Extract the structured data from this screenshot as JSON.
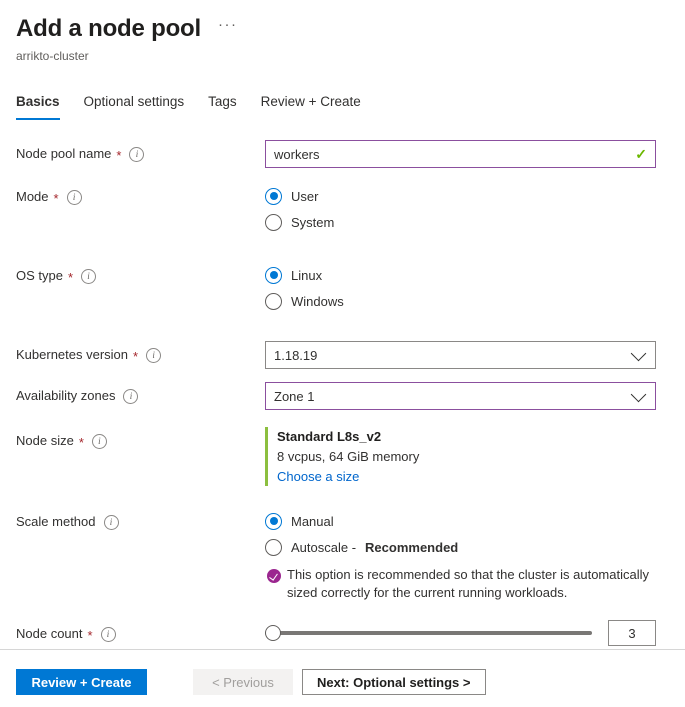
{
  "header": {
    "title": "Add a node pool",
    "subtitle": "arrikto-cluster",
    "more_menu": "···"
  },
  "tabs": [
    {
      "label": "Basics",
      "active": true
    },
    {
      "label": "Optional settings",
      "active": false
    },
    {
      "label": "Tags",
      "active": false
    },
    {
      "label": "Review + Create",
      "active": false
    }
  ],
  "form": {
    "node_pool_name": {
      "label": "Node pool name",
      "required": "*",
      "value": "workers",
      "validation_icon": "✓"
    },
    "mode": {
      "label": "Mode",
      "required": "*",
      "options": [
        {
          "label": "User",
          "selected": true
        },
        {
          "label": "System",
          "selected": false
        }
      ]
    },
    "os_type": {
      "label": "OS type",
      "required": "*",
      "options": [
        {
          "label": "Linux",
          "selected": true
        },
        {
          "label": "Windows",
          "selected": false
        }
      ]
    },
    "kubernetes_version": {
      "label": "Kubernetes version",
      "required": "*",
      "value": "1.18.19"
    },
    "availability_zones": {
      "label": "Availability zones",
      "required": "",
      "value": "Zone 1"
    },
    "node_size": {
      "label": "Node size",
      "required": "*",
      "size_name": "Standard L8s_v2",
      "size_spec": "8 vcpus, 64 GiB memory",
      "choose_link": "Choose a size"
    },
    "scale_method": {
      "label": "Scale method",
      "required": "",
      "options": [
        {
          "label": "Manual",
          "selected": true,
          "suffix": ""
        },
        {
          "label": "Autoscale - ",
          "selected": false,
          "suffix": "Recommended"
        }
      ],
      "recommendation": "This option is recommended so that the cluster is automatically sized correctly for the current running workloads."
    },
    "node_count": {
      "label": "Node count",
      "required": "*",
      "value": "3",
      "slider_percent": 0
    }
  },
  "footer": {
    "review_create": "Review + Create",
    "previous": "< Previous",
    "next": "Next: Optional settings >"
  },
  "colors": {
    "accent_blue": "#0078d4",
    "field_accent_purple": "#8b4f9e",
    "valid_green": "#6bb700",
    "node_size_bar_green": "#8cbf3f",
    "required_red": "#a4262c",
    "reco_purple": "#9b268f"
  }
}
